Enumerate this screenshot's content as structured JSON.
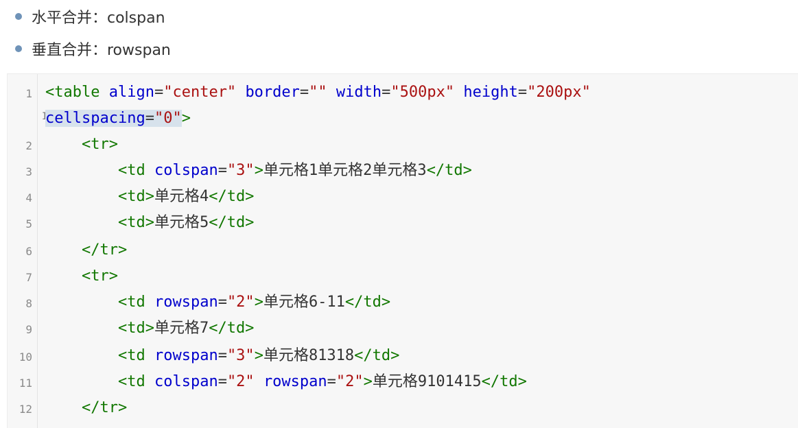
{
  "bullets": [
    {
      "text": "水平合并：colspan"
    },
    {
      "text": "垂直合并：rowspan"
    }
  ],
  "code": {
    "line_numbers": [
      "1",
      "",
      "2",
      "3",
      "4",
      "5",
      "6",
      "7",
      "8",
      "9",
      "10",
      "11",
      "12"
    ],
    "l1": {
      "open": "<table",
      "attr_align": "align",
      "eq": "=",
      "val_align": "\"center\"",
      "attr_border": "border",
      "val_border": "\"\"",
      "attr_width": "width",
      "val_width": "\"500px\"",
      "attr_height": "height",
      "val_height": "\"200px\""
    },
    "l1b": {
      "attr_cellspacing": "cellspacing",
      "eq": "=",
      "val_cellspacing": "\"0\"",
      "close": ">"
    },
    "l2": {
      "tag": "<tr>"
    },
    "l3": {
      "open": "<td",
      "attr": "colspan",
      "eq": "=",
      "val": "\"3\"",
      "gt": ">",
      "text": "单元格1单元格2单元格3",
      "close": "</td>"
    },
    "l4": {
      "open": "<td>",
      "text": "单元格4",
      "close": "</td>"
    },
    "l5": {
      "open": "<td>",
      "text": "单元格5",
      "close": "</td>"
    },
    "l6": {
      "tag": "</tr>"
    },
    "l7": {
      "tag": "<tr>"
    },
    "l8": {
      "open": "<td",
      "attr": "rowspan",
      "eq": "=",
      "val": "\"2\"",
      "gt": ">",
      "text": "单元格6-11",
      "close": "</td>"
    },
    "l9": {
      "open": "<td>",
      "text": "单元格7",
      "close": "</td>"
    },
    "l10": {
      "open": "<td",
      "attr": "rowspan",
      "eq": "=",
      "val": "\"3\"",
      "gt": ">",
      "text": "单元格81318",
      "close": "</td>"
    },
    "l11": {
      "open": "<td",
      "attr1": "colspan",
      "eq": "=",
      "val1": "\"2\"",
      "attr2": "rowspan",
      "val2": "\"2\"",
      "gt": ">",
      "text": "单元格9101415",
      "close": "</td>"
    },
    "l12": {
      "tag": "</tr>"
    },
    "caret_glyph": "I"
  }
}
